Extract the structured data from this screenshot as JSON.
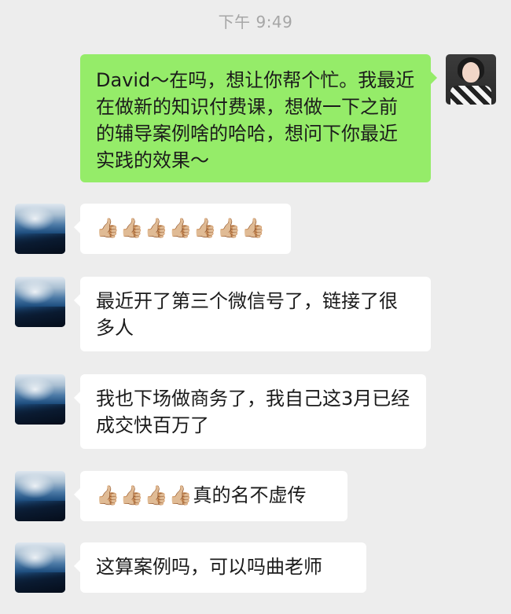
{
  "chat": {
    "timestamp": "下午 9:49",
    "messages": [
      {
        "sender": "me",
        "text": "David～在吗，想让你帮个忙。我最近在做新的知识付费课，想做一下之前的辅导案例啥的哈哈，想问下你最近实践的效果～"
      },
      {
        "sender": "other",
        "text": "👍🏼👍🏼👍🏼👍🏼👍🏼👍🏼👍🏼"
      },
      {
        "sender": "other",
        "text": "最近开了第三个微信号了，链接了很多人"
      },
      {
        "sender": "other",
        "text": "我也下场做商务了，我自己这3月已经成交快百万了"
      },
      {
        "sender": "other",
        "thumbs": "👍🏼👍🏼👍🏼👍🏼",
        "text": "真的名不虚传"
      },
      {
        "sender": "other",
        "text": "这算案例吗，可以吗曲老师"
      }
    ]
  }
}
